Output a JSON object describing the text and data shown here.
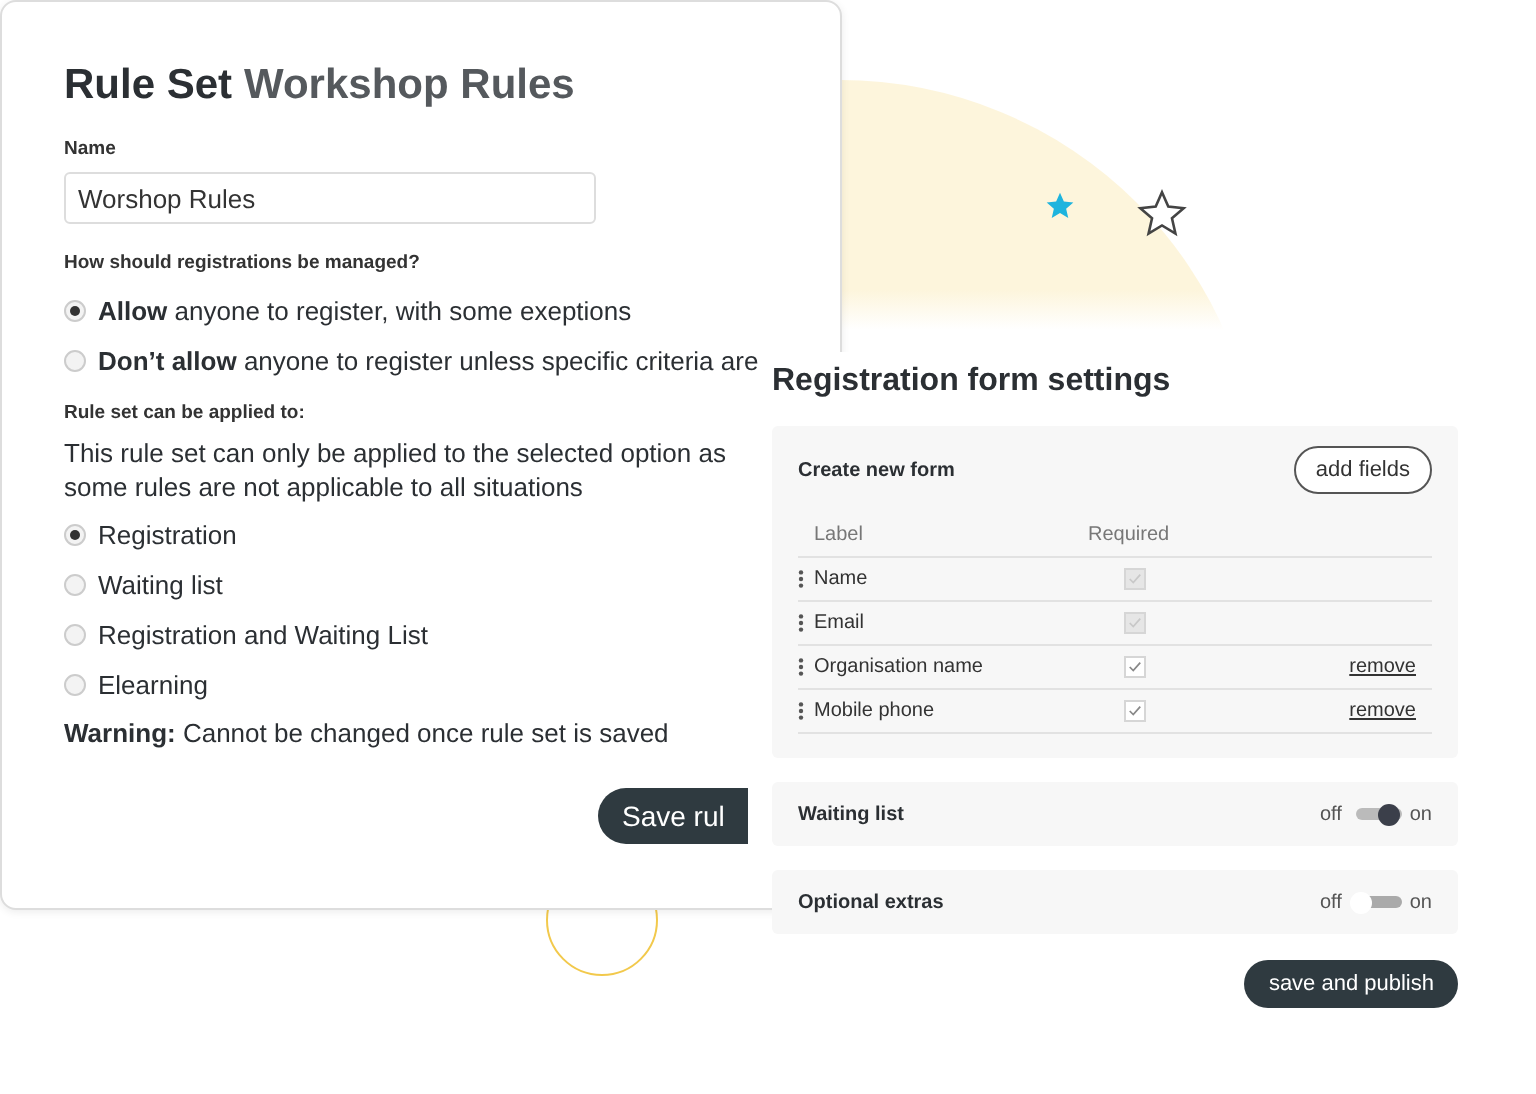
{
  "rule_set": {
    "title_prefix": "Rule Set",
    "title_name": "Workshop Rules",
    "name_label": "Name",
    "name_value": "Worshop Rules",
    "manage_question": "How should registrations be managed?",
    "manage_options": [
      {
        "text": "**Allow** anyone to register, with some exeptions",
        "selected": true
      },
      {
        "text": "**Don’t allow** anyone to register unless specific criteria are",
        "selected": false
      }
    ],
    "applied_label": "Rule set can be applied to:",
    "applied_note": "This rule set can only be applied to the selected option as some rules are not applicable to all situations",
    "applied_options": [
      {
        "label": "Registration",
        "selected": true
      },
      {
        "label": "Waiting list",
        "selected": false
      },
      {
        "label": "Registration and Waiting List",
        "selected": false
      },
      {
        "label": "Elearning",
        "selected": false
      }
    ],
    "warning": "**Warning:** Cannot be changed once rule set is saved",
    "save_button": "Save rul"
  },
  "form_settings": {
    "title": "Registration form settings",
    "create_form": {
      "title": "Create new form",
      "add_button": "add fields",
      "columns": [
        "Label",
        "Required"
      ],
      "fields": [
        {
          "label": "Name",
          "required": true,
          "disabled": true
        },
        {
          "label": "Email",
          "required": true,
          "disabled": true
        },
        {
          "label": "Organisation name",
          "required": true,
          "disabled": false,
          "remove": "remove"
        },
        {
          "label": "Mobile phone",
          "required": true,
          "disabled": false,
          "remove": "remove"
        }
      ]
    },
    "toggles": [
      {
        "label": "Waiting list",
        "off_label": "off",
        "on_label": "on",
        "on": true
      },
      {
        "label": "Optional extras",
        "off_label": "off",
        "on_label": "on",
        "on": false
      }
    ],
    "publish_button": "save and publish"
  }
}
